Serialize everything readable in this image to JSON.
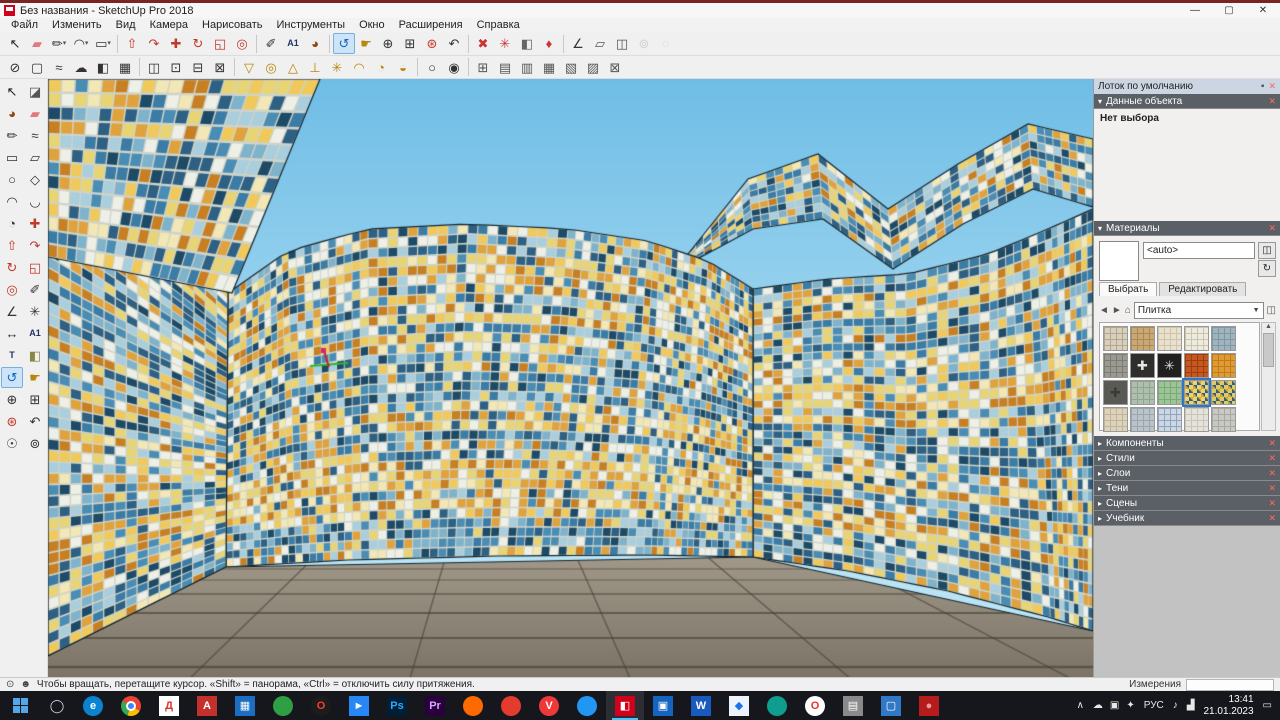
{
  "window": {
    "title": "Без названия - SketchUp Pro 2018"
  },
  "menu": {
    "items": [
      "Файл",
      "Изменить",
      "Вид",
      "Камера",
      "Нарисовать",
      "Инструменты",
      "Окно",
      "Расширения",
      "Справка"
    ]
  },
  "toolbar_main": {
    "items": [
      {
        "n": "select",
        "g": "↖",
        "c": "#222222"
      },
      {
        "n": "eraser",
        "g": "▰",
        "c": "#e07b7b"
      },
      {
        "n": "line",
        "g": "✏",
        "c": "#333333",
        "dd": 1
      },
      {
        "n": "arc",
        "g": "◠",
        "c": "#333333",
        "dd": 1
      },
      {
        "n": "shapes",
        "g": "▭",
        "c": "#333333",
        "dd": 1
      },
      {
        "sep": 1
      },
      {
        "n": "push-pull",
        "g": "⇧",
        "c": "#c0392b"
      },
      {
        "n": "follow-me",
        "g": "↷",
        "c": "#c0392b"
      },
      {
        "n": "move",
        "g": "✚",
        "c": "#c0392b"
      },
      {
        "n": "rotate",
        "g": "↻",
        "c": "#c0392b"
      },
      {
        "n": "scale",
        "g": "◱",
        "c": "#c0392b"
      },
      {
        "n": "offset",
        "g": "◎",
        "c": "#c0392b"
      },
      {
        "sep": 1
      },
      {
        "n": "tape-measure",
        "g": "✐",
        "c": "#333333"
      },
      {
        "n": "text",
        "g": "A1",
        "c": "#223366",
        "lbl": 1
      },
      {
        "n": "paint-bucket",
        "g": "◕",
        "c": "#8b4513"
      },
      {
        "sep": 1
      },
      {
        "n": "orbit",
        "g": "↺",
        "c": "#1565c0",
        "active": 1
      },
      {
        "n": "pan",
        "g": "☛",
        "c": "#b8860b"
      },
      {
        "n": "zoom",
        "g": "⊕",
        "c": "#333333"
      },
      {
        "n": "zoom-window",
        "g": "⊞",
        "c": "#333333"
      },
      {
        "n": "zoom-extents",
        "g": "⊛",
        "c": "#c0392b"
      },
      {
        "n": "previous-view",
        "g": "↶",
        "c": "#333333"
      },
      {
        "sep": 1
      },
      {
        "n": "position-texture",
        "g": "✖",
        "c": "#cc3333"
      },
      {
        "n": "fix-problems",
        "g": "✳",
        "c": "#cc3333"
      },
      {
        "n": "section-plane",
        "g": "◧",
        "c": "#666666"
      },
      {
        "n": "section-fill",
        "g": "♦",
        "c": "#cc3333"
      },
      {
        "sep": 1
      },
      {
        "n": "level",
        "g": "∠",
        "c": "#333333"
      },
      {
        "n": "box-tool",
        "g": "▱",
        "c": "#555555"
      },
      {
        "n": "box-tool-2",
        "g": "◫",
        "c": "#555555"
      },
      {
        "n": "walk",
        "g": "⊚",
        "c": "#999999",
        "disabled": 1
      },
      {
        "n": "look-around",
        "g": "◌",
        "c": "#999999",
        "disabled": 1
      }
    ]
  },
  "toolbar_second": {
    "items": [
      {
        "n": "polygon",
        "g": "⊘",
        "c": "#333333"
      },
      {
        "n": "rounded-rect",
        "g": "▢",
        "c": "#333333"
      },
      {
        "n": "bezier",
        "g": "≈",
        "c": "#333333"
      },
      {
        "n": "cloud",
        "g": "☁",
        "c": "#333333"
      },
      {
        "n": "gradient",
        "g": "◧",
        "c": "#333333"
      },
      {
        "n": "image",
        "g": "▦",
        "c": "#333333"
      },
      {
        "sep": 1
      },
      {
        "n": "frame-1",
        "g": "◫",
        "c": "#333333"
      },
      {
        "n": "frame-2",
        "g": "⊡",
        "c": "#333333"
      },
      {
        "n": "frame-3",
        "g": "⊟",
        "c": "#333333"
      },
      {
        "n": "lock",
        "g": "⊠",
        "c": "#333333"
      },
      {
        "sep": 1
      },
      {
        "n": "funnel",
        "g": "▽",
        "c": "#b8860b"
      },
      {
        "n": "target",
        "g": "◎",
        "c": "#b8860b"
      },
      {
        "n": "cone",
        "g": "△",
        "c": "#b8860b"
      },
      {
        "n": "stake",
        "g": "⊥",
        "c": "#b8860b"
      },
      {
        "n": "burst",
        "g": "✳",
        "c": "#b8860b"
      },
      {
        "n": "dome",
        "g": "◠",
        "c": "#b8860b"
      },
      {
        "n": "quarter-round",
        "g": "◔",
        "c": "#b8860b"
      },
      {
        "n": "half-round",
        "g": "◒",
        "c": "#b8860b"
      },
      {
        "sep": 1
      },
      {
        "n": "circle-tool",
        "g": "○",
        "c": "#333333"
      },
      {
        "n": "ring-tool",
        "g": "◉",
        "c": "#333333"
      },
      {
        "sep": 1
      },
      {
        "n": "grid",
        "g": "⊞",
        "c": "#555555"
      },
      {
        "n": "rows",
        "g": "▤",
        "c": "#555555"
      },
      {
        "n": "columns",
        "g": "▥",
        "c": "#555555"
      },
      {
        "n": "cells",
        "g": "▦",
        "c": "#555555"
      },
      {
        "n": "diagonal",
        "g": "▧",
        "c": "#555555"
      },
      {
        "n": "diagonal-2",
        "g": "▨",
        "c": "#555555"
      },
      {
        "n": "box-x",
        "g": "⊠",
        "c": "#555555"
      }
    ]
  },
  "tool_palette": {
    "items": [
      {
        "n": "select",
        "g": "↖",
        "c": "#222222"
      },
      {
        "n": "make-component",
        "g": "◪",
        "c": "#555555"
      },
      {
        "n": "paint",
        "g": "◕",
        "c": "#8b4513"
      },
      {
        "n": "erase",
        "g": "▰",
        "c": "#e07b7b"
      },
      {
        "n": "line",
        "g": "✏",
        "c": "#333333"
      },
      {
        "n": "freehand",
        "g": "≈",
        "c": "#333333"
      },
      {
        "n": "rectangle",
        "g": "▭",
        "c": "#333333"
      },
      {
        "n": "rotated-rectangle",
        "g": "▱",
        "c": "#333333"
      },
      {
        "n": "circle",
        "g": "○",
        "c": "#333333"
      },
      {
        "n": "polygon",
        "g": "◇",
        "c": "#333333"
      },
      {
        "n": "arc",
        "g": "◠",
        "c": "#333333"
      },
      {
        "n": "arc-2",
        "g": "◡",
        "c": "#333333"
      },
      {
        "n": "pie",
        "g": "◔",
        "c": "#333333"
      },
      {
        "n": "move",
        "g": "✚",
        "c": "#c0392b"
      },
      {
        "n": "push-pull",
        "g": "⇧",
        "c": "#c0392b"
      },
      {
        "n": "follow-me",
        "g": "↷",
        "c": "#c0392b"
      },
      {
        "n": "rotate",
        "g": "↻",
        "c": "#c0392b"
      },
      {
        "n": "scale",
        "g": "◱",
        "c": "#c0392b"
      },
      {
        "n": "offset",
        "g": "◎",
        "c": "#c0392b"
      },
      {
        "n": "tape-measure",
        "g": "✐",
        "c": "#333333"
      },
      {
        "n": "protractor",
        "g": "∠",
        "c": "#333333"
      },
      {
        "n": "axes",
        "g": "✳",
        "c": "#333333"
      },
      {
        "n": "dimensions",
        "g": "↔",
        "c": "#333333"
      },
      {
        "n": "text",
        "g": "A1",
        "c": "#223366",
        "lbl": 1
      },
      {
        "n": "text-3d",
        "g": "T",
        "c": "#223366",
        "lbl": 1
      },
      {
        "n": "section-plane",
        "g": "◧",
        "c": "#888844"
      },
      {
        "n": "orbit",
        "g": "↺",
        "c": "#1565c0",
        "active": 1
      },
      {
        "n": "pan",
        "g": "☛",
        "c": "#b8860b"
      },
      {
        "n": "zoom",
        "g": "⊕",
        "c": "#333333"
      },
      {
        "n": "zoom-window",
        "g": "⊞",
        "c": "#333333"
      },
      {
        "n": "zoom-extents",
        "g": "⊛",
        "c": "#c0392b"
      },
      {
        "n": "previous-view",
        "g": "↶",
        "c": "#333333"
      },
      {
        "n": "position-camera",
        "g": "☉",
        "c": "#333333"
      },
      {
        "n": "walk",
        "g": "⊚",
        "c": "#333333"
      }
    ]
  },
  "tray": {
    "title": "Лоток по умолчанию",
    "entity_info": {
      "title": "Данные объекта",
      "empty_text": "Нет выбора"
    },
    "materials": {
      "title": "Материалы",
      "current_value": "<auto>",
      "tabs": [
        {
          "n": "select",
          "label": "Выбрать",
          "active": true
        },
        {
          "n": "edit",
          "label": "Редактировать",
          "active": false
        }
      ],
      "collection": "Плитка",
      "swatches": [
        {
          "n": "tile-beige-grid",
          "c1": "#d8cfbf",
          "c2": "#b3a68f",
          "k": "grid"
        },
        {
          "n": "tile-tan",
          "c1": "#c9a876",
          "c2": "#a98a55",
          "k": "grid"
        },
        {
          "n": "tile-cream",
          "c1": "#e9e1cf",
          "c2": "#cfc3a8",
          "k": "grid"
        },
        {
          "n": "tile-white-speckle",
          "c1": "#edebdd",
          "c2": "#cbc5ae",
          "k": "grid"
        },
        {
          "n": "tile-blue-gray",
          "c1": "#9fb4bd",
          "c2": "#7e97a2",
          "k": "grid"
        },
        {
          "n": "tile-gray-stone",
          "c1": "#9a9a93",
          "c2": "#7c7c74",
          "k": "grid"
        },
        {
          "n": "tile-black-cross",
          "c1": "#2e2e2c",
          "c2": "#e6e6e2",
          "k": "cross"
        },
        {
          "n": "tile-black-star",
          "c1": "#202020",
          "c2": "#d9d9d4",
          "k": "star"
        },
        {
          "n": "tile-terracotta",
          "c1": "#c4581e",
          "c2": "#9c3f0e",
          "k": "grid"
        },
        {
          "n": "tile-orange",
          "c1": "#e09a33",
          "c2": "#bf7c1c",
          "k": "grid"
        },
        {
          "n": "tile-dark-pattern",
          "c1": "#5a5a54",
          "c2": "#3b3b36",
          "k": "cross"
        },
        {
          "n": "tile-sage",
          "c1": "#aebfae",
          "c2": "#8fa58f",
          "k": "grid"
        },
        {
          "n": "tile-green",
          "c1": "#9cc498",
          "c2": "#7aa976",
          "k": "grid"
        },
        {
          "n": "tile-blue-yellow-mosaic",
          "c1": "#e8d473",
          "c2": "#e0a23c",
          "k": "mosaic",
          "selected": true
        },
        {
          "n": "tile-yellow-mosaic",
          "c1": "#e3c964",
          "c2": "#c7a73e",
          "k": "mosaic"
        },
        {
          "n": "tile-beige",
          "c1": "#ddd3bd",
          "c2": "#c0b49a",
          "k": "grid"
        },
        {
          "n": "tile-gray-blue",
          "c1": "#b9c3c9",
          "c2": "#99a6ad",
          "k": "grid"
        },
        {
          "n": "tile-blue-speckle",
          "c1": "#ccd7e3",
          "c2": "#8ea5bf",
          "k": "grid"
        },
        {
          "n": "tile-light",
          "c1": "#e4e2d9",
          "c2": "#c9c5b8",
          "k": "grid"
        },
        {
          "n": "tile-gray",
          "c1": "#c9c9c3",
          "c2": "#a8a89f",
          "k": "grid"
        }
      ]
    },
    "collapsed_sections": [
      {
        "n": "components",
        "label": "Компоненты"
      },
      {
        "n": "styles",
        "label": "Стили"
      },
      {
        "n": "layers",
        "label": "Слои"
      },
      {
        "n": "shadows",
        "label": "Тени"
      },
      {
        "n": "scenes",
        "label": "Сцены"
      },
      {
        "n": "instructor",
        "label": "Учебник"
      }
    ]
  },
  "status_bar": {
    "hint": "Чтобы вращать, перетащите курсор. «Shift» = панорама, «Ctrl» = отключить силу притяжения.",
    "measure_label": "Измерения"
  },
  "taskbar": {
    "apps": [
      {
        "n": "edge",
        "g": "e",
        "bg": "#0a84d0",
        "fg": "#ffffff",
        "r": 1
      },
      {
        "n": "chrome",
        "g": "",
        "bg": "",
        "fg": "",
        "chrome": 1
      },
      {
        "n": "yandex-disk",
        "g": "Д",
        "bg": "#ffffff",
        "fg": "#e03131"
      },
      {
        "n": "adobe",
        "g": "A",
        "bg": "#c4302b",
        "fg": "#ffffff"
      },
      {
        "n": "photos",
        "g": "▦",
        "bg": "#1b6ec2",
        "fg": "#ffffff"
      },
      {
        "n": "green-app",
        "g": "",
        "bg": "#2ea043",
        "fg": "#ffffff",
        "r": 1
      },
      {
        "n": "opera",
        "g": "O",
        "bg": "#1c1c1c",
        "fg": "#ff3b30",
        "r": 1
      },
      {
        "n": "blue-app",
        "g": "►",
        "bg": "#2787f5",
        "fg": "#ffffff"
      },
      {
        "n": "photoshop",
        "g": "Ps",
        "bg": "#001e36",
        "fg": "#31a8ff"
      },
      {
        "n": "premiere",
        "g": "Pr",
        "bg": "#2a003f",
        "fg": "#d6a5ff"
      },
      {
        "n": "orange-app",
        "g": "",
        "bg": "#ff6a00",
        "fg": "#ffffff",
        "r": 1
      },
      {
        "n": "red-app",
        "g": "",
        "bg": "#e33b2e",
        "fg": "#ffffff",
        "r": 1
      },
      {
        "n": "vivaldi",
        "g": "V",
        "bg": "#ef3939",
        "fg": "#ffffff",
        "r": 1
      },
      {
        "n": "blue-round-app",
        "g": "",
        "bg": "#2196f3",
        "fg": "#ffffff",
        "r": 1
      },
      {
        "n": "sketchup",
        "g": "◧",
        "bg": "#d0021b",
        "fg": "#ffffff",
        "active": 1
      },
      {
        "n": "blue-square-app",
        "g": "▣",
        "bg": "#1565c0",
        "fg": "#ffffff"
      },
      {
        "n": "word",
        "g": "W",
        "bg": "#185abd",
        "fg": "#ffffff"
      },
      {
        "n": "light-app",
        "g": "◆",
        "bg": "#eef3fb",
        "fg": "#1a73e8"
      },
      {
        "n": "teal-app",
        "g": "",
        "bg": "#0f9d8f",
        "fg": "#ffffff",
        "r": 1
      },
      {
        "n": "opera-red",
        "g": "O",
        "bg": "#ffffff",
        "fg": "#e5322d",
        "r": 1
      },
      {
        "n": "gray-app",
        "g": "▤",
        "bg": "#8a8a8a",
        "fg": "#ffffff"
      },
      {
        "n": "blue-dev-app",
        "g": "▢",
        "bg": "#3178c6",
        "fg": "#ffffff"
      },
      {
        "n": "media-app",
        "g": "●",
        "bg": "#b71c1c",
        "fg": "#ef9a9a"
      }
    ],
    "tray_icons": [
      "☁",
      "▣",
      "✦"
    ],
    "chevron": "∧",
    "lang": "РУС",
    "volume_icon": "♪",
    "network_icon": "▟",
    "time": "13:41",
    "date": "21.01.2023",
    "notif_icon": "▭"
  },
  "scene": {
    "sky_top": "#6fbde6",
    "sky_bottom": "#b9e4f6",
    "grout": "#cfd3c9",
    "outline": "#13242e",
    "floor_top": "#a39a8a",
    "floor_bottom": "#7b7467",
    "floor_line": "rgba(66,60,52,0.6)",
    "blues": [
      "#1d4a66",
      "#2d6083",
      "#3a7ca6",
      "#4a8db4",
      "#7fb3cc",
      "#a9cede"
    ],
    "warms": [
      "#e8d473",
      "#f2e7b5",
      "#e0a23c",
      "#c77f22",
      "#f0c95a"
    ],
    "white": "#eef0e8",
    "axes": {
      "red": "#d02020",
      "green": "#2db82d"
    }
  }
}
